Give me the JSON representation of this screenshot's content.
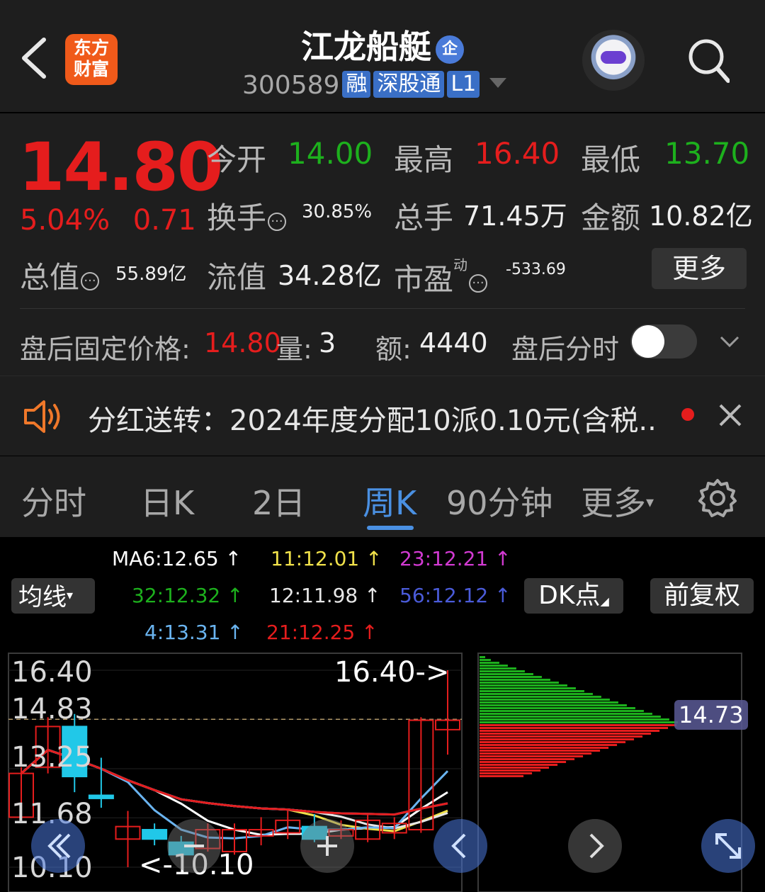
{
  "header": {
    "back_label": "<",
    "logo_text": [
      "东方",
      "财富"
    ],
    "title": "江龙船艇",
    "title_badge": "企",
    "code": "300589",
    "tags": [
      "融",
      "深股通",
      "L1"
    ]
  },
  "quote": {
    "price": "14.80",
    "change_pct": "5.04%",
    "change_abs": "0.71",
    "open_label": "今开",
    "open": "14.00",
    "high_label": "最高",
    "high": "16.40",
    "low_label": "最低",
    "low": "13.70",
    "turnover_label": "换手",
    "turnover": "30.85%",
    "volume_label": "总手",
    "volume": "71.45万",
    "amount_label": "金额",
    "amount": "10.82亿",
    "mktcap_label": "总值",
    "mktcap": "55.89亿",
    "float_label": "流值",
    "float": "34.28亿",
    "pe_label": "市盈",
    "pe_sup": "动",
    "pe": "-533.69",
    "more_label": "更多",
    "after_label": "盘后固定价格:",
    "after_price": "14.80",
    "after_vol_label": "量:",
    "after_vol": "3",
    "after_amt_label": "额:",
    "after_amt": "4440",
    "after_tl_label": "盘后分时"
  },
  "notice": {
    "text": "分红送转：2024年度分配10派0.10元(含税.."
  },
  "tabs": [
    "分时",
    "日K",
    "2日",
    "周K",
    "90分钟",
    "更多"
  ],
  "active_tab": "周K",
  "indicators": {
    "junxian": "均线",
    "ma": [
      {
        "text": "MA6:12.65",
        "color": "#ffffff"
      },
      {
        "text": "11:12.01",
        "color": "#f0e14a"
      },
      {
        "text": "23:12.21",
        "color": "#d23ad2"
      },
      {
        "text": "32:12.32",
        "color": "#1db01d"
      },
      {
        "text": "12:11.98",
        "color": "#e6e6e6"
      },
      {
        "text": "56:12.12",
        "color": "#4a5bd9"
      },
      {
        "text": "4:13.31",
        "color": "#6ab4f0"
      },
      {
        "text": "21:12.25",
        "color": "#e51d1d"
      }
    ],
    "dk_label": "DK点",
    "fq_label": "前复权"
  },
  "chart_data": {
    "type": "candlestick",
    "period": "周K",
    "y_ticks": [
      "16.40",
      "14.83",
      "13.25",
      "11.68",
      "10.10"
    ],
    "max_marker": "16.40->",
    "min_marker": "<-10.10",
    "profile_price": "14.73",
    "candles": [
      {
        "open": 11.7,
        "close": 13.1,
        "high": 13.3,
        "low": 11.6
      },
      {
        "open": 13.3,
        "close": 14.6,
        "high": 14.9,
        "low": 13.1
      },
      {
        "open": 14.6,
        "close": 13.0,
        "high": 15.0,
        "low": 12.5
      },
      {
        "open": 12.4,
        "close": 12.3,
        "high": 13.6,
        "low": 12.0
      },
      {
        "open": 11.0,
        "close": 11.4,
        "high": 11.9,
        "low": 10.1
      },
      {
        "open": 11.3,
        "close": 11.0,
        "high": 11.5,
        "low": 10.8
      },
      {
        "open": 10.9,
        "close": 10.5,
        "high": 11.1,
        "low": 10.4
      },
      {
        "open": 10.7,
        "close": 11.3,
        "high": 11.5,
        "low": 10.6
      },
      {
        "open": 10.6,
        "close": 11.3,
        "high": 11.5,
        "low": 10.5
      },
      {
        "open": 11.1,
        "close": 11.3,
        "high": 11.7,
        "low": 10.8
      },
      {
        "open": 11.2,
        "close": 11.6,
        "high": 11.9,
        "low": 11.0
      },
      {
        "open": 11.4,
        "close": 11.0,
        "high": 11.8,
        "low": 10.9
      },
      {
        "open": 11.1,
        "close": 11.3,
        "high": 11.6,
        "low": 11.0
      },
      {
        "open": 11.0,
        "close": 11.6,
        "high": 11.8,
        "low": 10.9
      },
      {
        "open": 11.2,
        "close": 11.5,
        "high": 11.7,
        "low": 11.0
      },
      {
        "open": 11.3,
        "close": 14.8,
        "high": 14.9,
        "low": 11.2
      },
      {
        "open": 14.5,
        "close": 14.8,
        "high": 16.4,
        "low": 13.7
      }
    ]
  },
  "colors": {
    "red": "#e51d1d",
    "green": "#1db01d",
    "blue": "#4a90e2",
    "cyan": "#21c8e8"
  }
}
